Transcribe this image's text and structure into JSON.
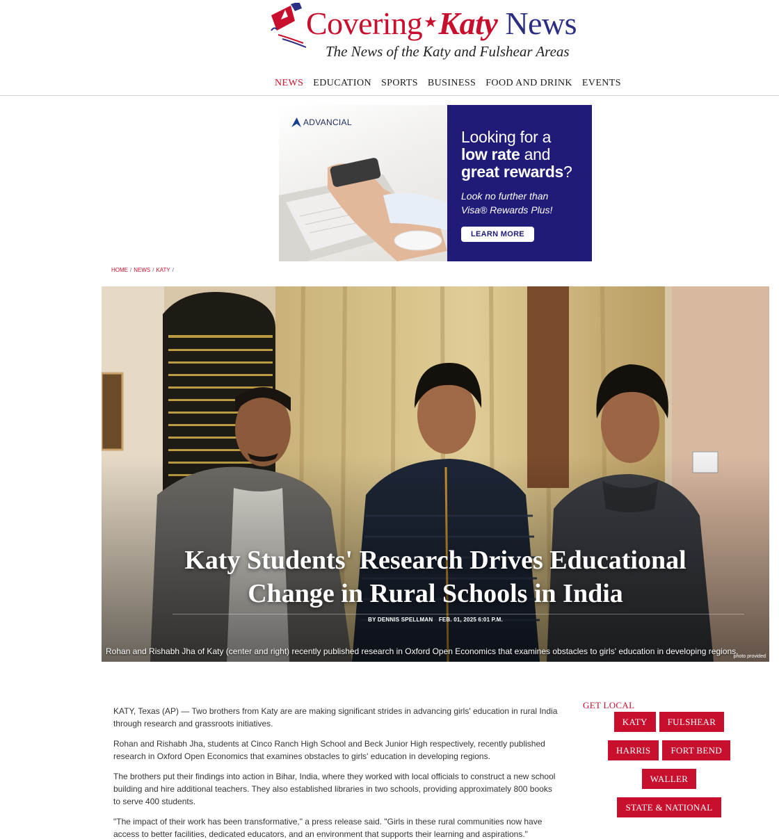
{
  "site": {
    "name_part1": "Covering",
    "name_part2": "Katy",
    "name_part3": "News",
    "tagline": "The News of the Katy and Fulshear Areas"
  },
  "nav": {
    "items": [
      "NEWS",
      "EDUCATION",
      "SPORTS",
      "BUSINESS",
      "FOOD AND DRINK",
      "EVENTS"
    ],
    "active": "NEWS"
  },
  "ad": {
    "brand": "ADVANCIAL",
    "headline_line1": "Looking for a",
    "headline_bold1": "low rate",
    "headline_line2": "and",
    "headline_bold2": "great rewards",
    "headline_q": "?",
    "sub_line1": "Look no further than",
    "sub_line2": "Visa® Rewards Plus!",
    "button": "LEARN MORE",
    "colors": {
      "panel": "#201a78"
    }
  },
  "breadcrumb": {
    "items": [
      "HOME",
      "NEWS",
      "KATY"
    ],
    "sep": "/"
  },
  "article": {
    "title": "Katy Students' Research Drives Educational Change in Rural Schools in India",
    "byline": "BY DENNIS SPELLMAN",
    "date": "FEB. 01, 2025 6:01 P.M.",
    "caption": "Rohan and Rishabh Jha of Katy (center and right) recently published research in Oxford Open Economics that examines obstacles to girls' education in developing regions.",
    "photo_credit": "photo provided",
    "paragraphs": [
      "KATY, Texas (AP) — Two brothers from Katy are are making significant strides in advancing girls' education in rural India through research and grassroots initiatives.",
      "Rohan and Rishabh Jha, students at Cinco Ranch High School and Beck Junior High respectively, recently published research in Oxford Open Economics that examines obstacles to girls' education in developing regions.",
      "The brothers put their findings into action in Bihar, India, where they worked with local officials to construct a new school building and hire additional teachers. They also established libraries in two schools, providing approximately 800 books to serve 400 students.",
      "\"The impact of their work has been transformative,\" a press release said. \"Girls in these rural communities now have access to better facilities, dedicated educators, and an environment that supports their learning and aspirations.\""
    ]
  },
  "sidebar": {
    "title": "GET LOCAL",
    "tags": [
      "KATY",
      "FULSHEAR",
      "HARRIS",
      "FORT BEND",
      "WALLER",
      "STATE & NATIONAL"
    ]
  },
  "colors": {
    "brand_red": "#c8102e",
    "brand_blue": "#2b2e83"
  }
}
